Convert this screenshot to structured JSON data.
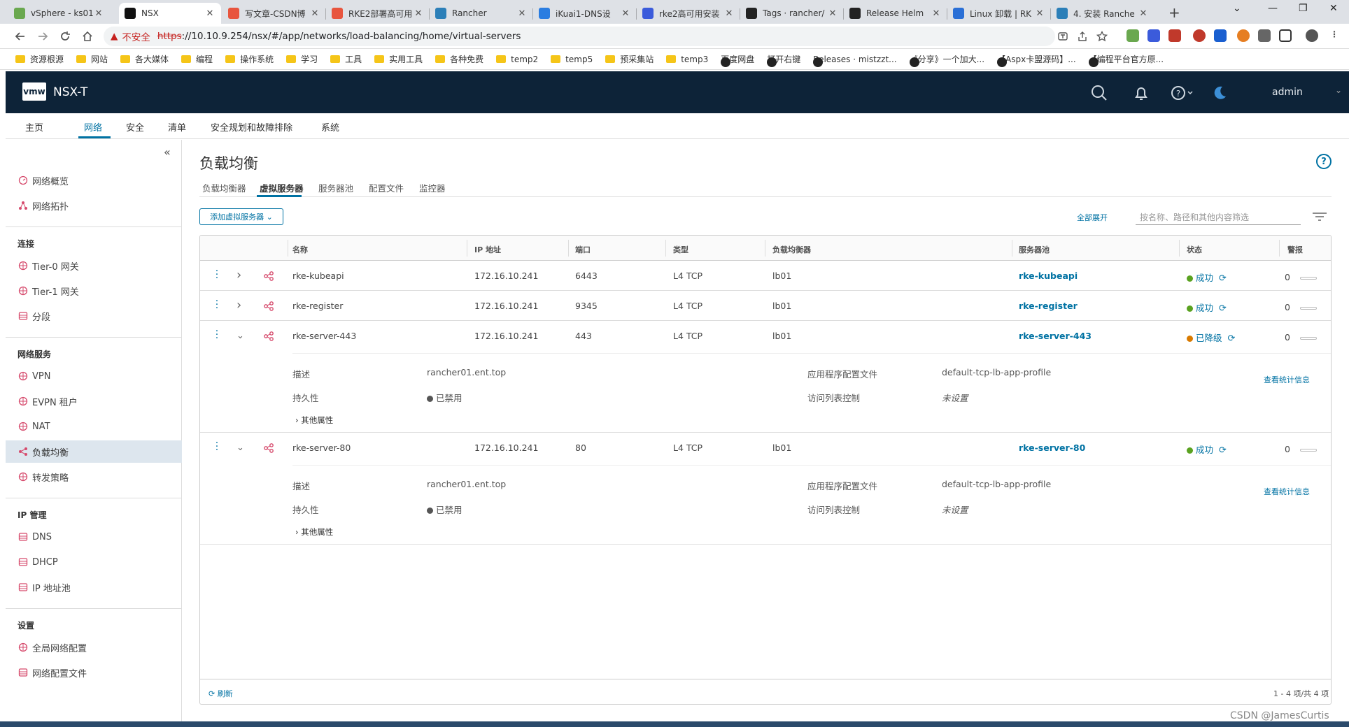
{
  "browser": {
    "tabs": [
      {
        "title": "vSphere - ks01",
        "color": "#6aa84f",
        "active": false
      },
      {
        "title": "NSX",
        "color": "#111111",
        "active": true
      },
      {
        "title": "写文章-CSDN博",
        "color": "#e8553e",
        "active": false
      },
      {
        "title": "RKE2部署高可用",
        "color": "#e8553e",
        "active": false
      },
      {
        "title": "Rancher",
        "color": "#2c7fb8",
        "active": false
      },
      {
        "title": "iKuai1-DNS设",
        "color": "#2a7de1",
        "active": false
      },
      {
        "title": "rke2高可用安装",
        "color": "#3b5bdb",
        "active": false
      },
      {
        "title": "Tags · rancher/",
        "color": "#222222",
        "active": false
      },
      {
        "title": "Release Helm",
        "color": "#222222",
        "active": false
      },
      {
        "title": "Linux 卸载 | RK",
        "color": "#2a6fd6",
        "active": false
      },
      {
        "title": "4. 安装 Ranche",
        "color": "#2c7fb8",
        "active": false
      }
    ],
    "address": {
      "warning": "不安全",
      "https": "https",
      "rest": "://10.10.9.254/nsx/#/app/networks/load-balancing/home/virtual-servers"
    },
    "bookmarks": [
      {
        "label": "资源根源",
        "type": "folder"
      },
      {
        "label": "网站",
        "type": "folder"
      },
      {
        "label": "各大媒体",
        "type": "folder"
      },
      {
        "label": "编程",
        "type": "folder"
      },
      {
        "label": "操作系统",
        "type": "folder"
      },
      {
        "label": "学习",
        "type": "folder"
      },
      {
        "label": "工具",
        "type": "folder"
      },
      {
        "label": "实用工具",
        "type": "folder"
      },
      {
        "label": "各种免费",
        "type": "folder"
      },
      {
        "label": "temp2",
        "type": "folder"
      },
      {
        "label": "temp5",
        "type": "folder"
      },
      {
        "label": "预采集站",
        "type": "folder"
      },
      {
        "label": "temp3",
        "type": "folder"
      },
      {
        "label": "百度网盘",
        "type": "site"
      },
      {
        "label": "打开右键",
        "type": "site"
      },
      {
        "label": "Releases · mistzzt...",
        "type": "site"
      },
      {
        "label": "《分享》一个加大...",
        "type": "site"
      },
      {
        "label": "【Aspx卡盟源码】...",
        "type": "site"
      },
      {
        "label": "【编程平台官方原...",
        "type": "site"
      }
    ]
  },
  "app": {
    "logo": "vmw",
    "product": "NSX-T",
    "user": "admin",
    "nav": [
      "主页",
      "网络",
      "安全",
      "清单",
      "安全规划和故障排除",
      "系统"
    ],
    "active_nav": 1
  },
  "sidebar": {
    "top_items": [
      "网络概览",
      "网络拓扑"
    ],
    "sections": [
      {
        "title": "连接",
        "items": [
          "Tier-0 网关",
          "Tier-1 网关",
          "分段"
        ]
      },
      {
        "title": "网络服务",
        "items": [
          "VPN",
          "EVPN 租户",
          "NAT",
          "负载均衡",
          "转发策略"
        ]
      },
      {
        "title": "IP 管理",
        "items": [
          "DNS",
          "DHCP",
          "IP 地址池"
        ]
      },
      {
        "title": "设置",
        "items": [
          "全局网络配置",
          "网络配置文件"
        ]
      }
    ],
    "active": "负载均衡"
  },
  "page": {
    "title": "负载均衡",
    "subtabs": [
      "负载均衡器",
      "虚拟服务器",
      "服务器池",
      "配置文件",
      "监控器"
    ],
    "active_subtab": 1,
    "add_button": "添加虚拟服务器",
    "expand_all": "全部展开",
    "filter_placeholder": "按名称、路径和其他内容筛选"
  },
  "table": {
    "columns": [
      "名称",
      "IP 地址",
      "端口",
      "类型",
      "负载均衡器",
      "服务器池",
      "状态",
      "警报"
    ],
    "rows": [
      {
        "name": "rke-kubeapi",
        "ip": "172.16.10.241",
        "port": "6443",
        "type": "L4 TCP",
        "lb": "lb01",
        "pool": "rke-kubeapi",
        "status": "成功",
        "status_color": "#5aa220",
        "alarms": "0",
        "expanded": false
      },
      {
        "name": "rke-register",
        "ip": "172.16.10.241",
        "port": "9345",
        "type": "L4 TCP",
        "lb": "lb01",
        "pool": "rke-register",
        "status": "成功",
        "status_color": "#5aa220",
        "alarms": "0",
        "expanded": false
      },
      {
        "name": "rke-server-443",
        "ip": "172.16.10.241",
        "port": "443",
        "type": "L4 TCP",
        "lb": "lb01",
        "pool": "rke-server-443",
        "status": "已降级",
        "status_color": "#d97a00",
        "alarms": "0",
        "expanded": true
      },
      {
        "name": "rke-server-80",
        "ip": "172.16.10.241",
        "port": "80",
        "type": "L4 TCP",
        "lb": "lb01",
        "pool": "rke-server-80",
        "status": "成功",
        "status_color": "#5aa220",
        "alarms": "0",
        "expanded": true
      }
    ],
    "details": [
      {
        "desc_label": "描述",
        "desc": "rancher01.ent.top",
        "persist_label": "持久性",
        "persist": "已禁用",
        "profile_label": "应用程序配置文件",
        "profile": "default-tcp-lb-app-profile",
        "acl_label": "访问列表控制",
        "acl": "未设置",
        "more": "其他属性",
        "stats": "查看统计信息"
      },
      {
        "desc_label": "描述",
        "desc": "rancher01.ent.top",
        "persist_label": "持久性",
        "persist": "已禁用",
        "profile_label": "应用程序配置文件",
        "profile": "default-tcp-lb-app-profile",
        "acl_label": "访问列表控制",
        "acl": "未设置",
        "more": "其他属性",
        "stats": "查看统计信息"
      }
    ],
    "refresh": "刷新",
    "pagination": "1 - 4 项/共 4 项"
  },
  "watermark": "CSDN @JamesCurtis"
}
